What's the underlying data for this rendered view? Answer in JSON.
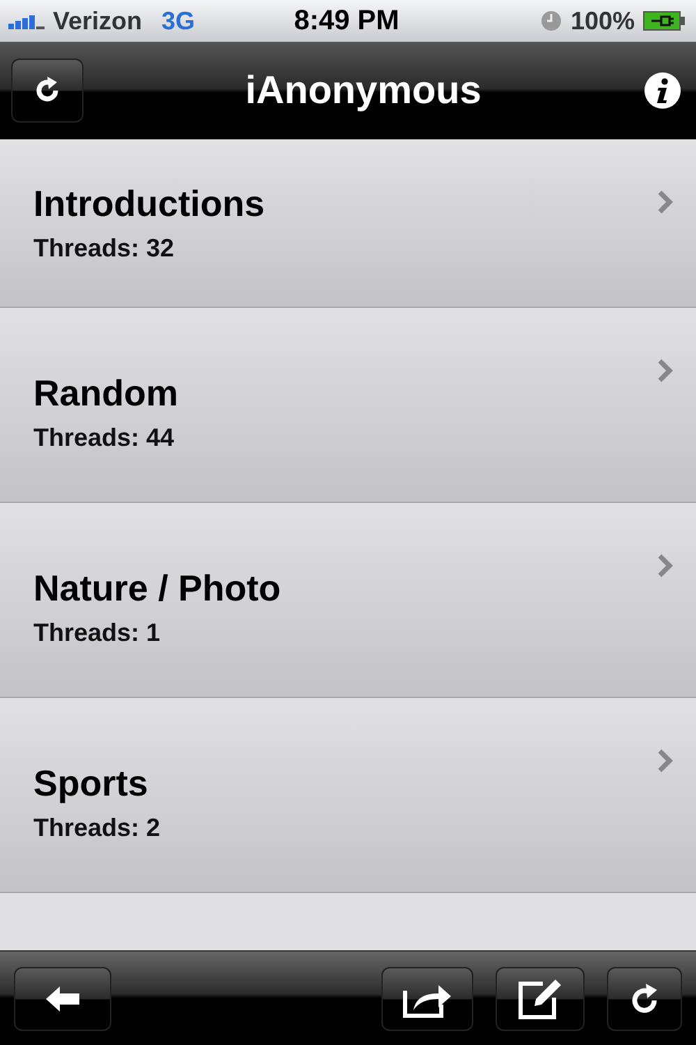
{
  "status_bar": {
    "carrier": "Verizon",
    "network": "3G",
    "time": "8:49 PM",
    "battery": "100%"
  },
  "nav_bar": {
    "title": "iAnonymous"
  },
  "forums": [
    {
      "name": "Introductions",
      "threads": "Threads: 32"
    },
    {
      "name": "Random",
      "threads": "Threads: 44"
    },
    {
      "name": "Nature / Photo",
      "threads": "Threads: 1"
    },
    {
      "name": "Sports",
      "threads": "Threads: 2"
    }
  ]
}
